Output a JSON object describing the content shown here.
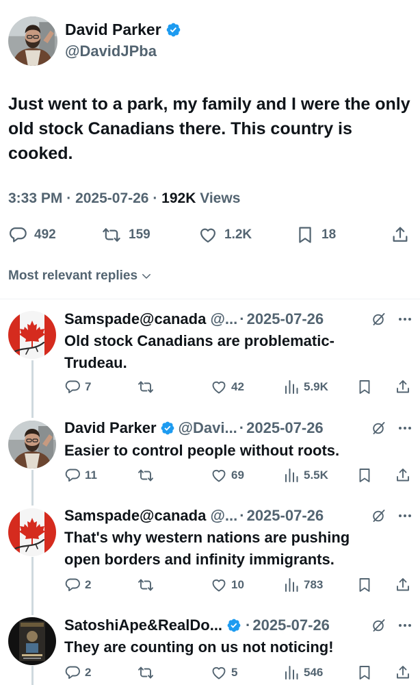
{
  "main_tweet": {
    "author_name": "David Parker",
    "handle": "@DavidJPba",
    "text": "Just went to a park, my family and I were the only old stock Canadians there. This country is cooked.",
    "time": "3:33 PM",
    "date": "2025-07-26",
    "views_count": "192K",
    "views_label": "Views",
    "replies": "492",
    "retweets": "159",
    "likes": "1.2K",
    "bookmarks": "18"
  },
  "sort_label": "Most relevant replies",
  "separator": "·",
  "replies": [
    {
      "author": "Samspade@canada",
      "handle": "@...",
      "date": "2025-07-26",
      "text": "Old stock Canadians are problematic- Trudeau.",
      "reply_count": "7",
      "likes": "42",
      "views": "5.9K",
      "avatar": "canada-flag",
      "verified": false
    },
    {
      "author": "David Parker",
      "handle": "@Davi...",
      "date": "2025-07-26",
      "text": "Easier to control people without roots.",
      "reply_count": "11",
      "likes": "69",
      "views": "5.5K",
      "avatar": "person-photo",
      "verified": true
    },
    {
      "author": "Samspade@canada",
      "handle": "@...",
      "date": "2025-07-26",
      "text": "That's why western nations are pushing open borders and infinity immigrants.",
      "reply_count": "2",
      "likes": "10",
      "views": "783",
      "avatar": "canada-flag",
      "verified": false
    },
    {
      "author": "SatoshiApe&RealDo...",
      "handle": "",
      "date": "2025-07-26",
      "text": "They are counting on us not noticing!",
      "reply_count": "2",
      "likes": "5",
      "views": "546",
      "avatar": "poster-image",
      "verified": true
    }
  ],
  "colors": {
    "text": "#0f1419",
    "secondary": "#536471",
    "verified": "#1d9bf0",
    "divider": "#eff3f4",
    "flag_red": "#d52b1e"
  },
  "icons": [
    "verified-badge-icon",
    "reply-icon",
    "retweet-icon",
    "like-icon",
    "bookmark-icon",
    "share-icon",
    "views-icon",
    "grok-icon",
    "more-icon",
    "chevron-down-icon"
  ]
}
